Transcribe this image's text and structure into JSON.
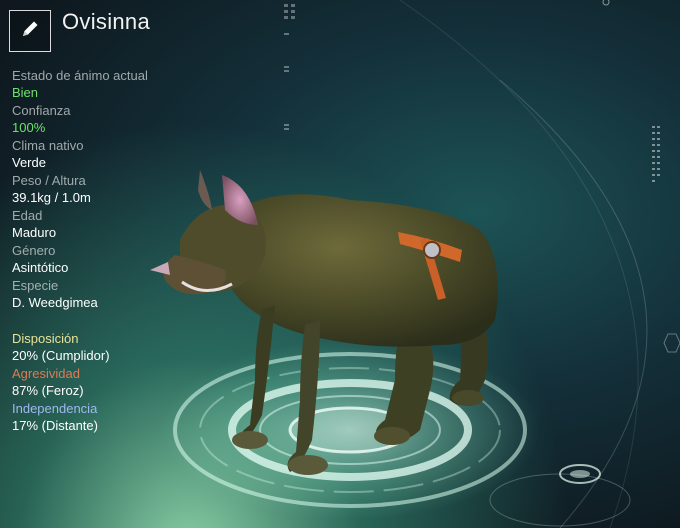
{
  "header": {
    "name": "Ovisinna",
    "edit_icon": "pencil-icon"
  },
  "stats": [
    {
      "label": "Estado de ánimo actual",
      "value": "Bien",
      "highlight": true
    },
    {
      "label": "Confianza",
      "value": "100%",
      "highlight": true
    },
    {
      "label": "Clima nativo",
      "value": "Verde",
      "highlight": false
    },
    {
      "label": "Peso / Altura",
      "value": "39.1kg / 1.0m",
      "highlight": false
    },
    {
      "label": "Edad",
      "value": "Maduro",
      "highlight": false
    },
    {
      "label": "Género",
      "value": "Asintótico",
      "highlight": false
    },
    {
      "label": "Especie",
      "value": "D. Weedgimea",
      "highlight": false
    }
  ],
  "traits": [
    {
      "label": "Disposición",
      "value": "20% (Cumplidor)",
      "color": "#e6e39a"
    },
    {
      "label": "Agresividad",
      "value": "87% (Feroz)",
      "color": "#e07a55"
    },
    {
      "label": "Independencia",
      "value": "17% (Distante)",
      "color": "#9fb8f0"
    }
  ],
  "colors": {
    "accent_green": "#6fe06f",
    "platform_glow": "#bff5da"
  }
}
